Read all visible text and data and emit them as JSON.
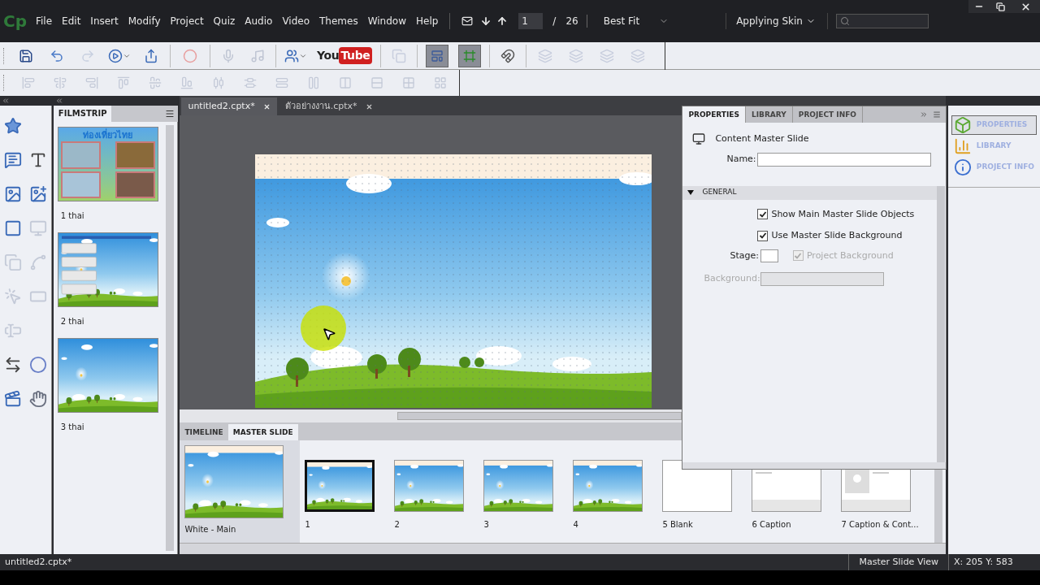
{
  "app": {
    "logo": "Cp"
  },
  "menu": [
    "File",
    "Edit",
    "Insert",
    "Modify",
    "Project",
    "Quiz",
    "Audio",
    "Video",
    "Themes",
    "Window",
    "Help"
  ],
  "nav": {
    "page": "1",
    "separator": "/",
    "total": "26",
    "zoom": "Best Fit"
  },
  "workspace": "Applying Skin",
  "toolbar": {
    "youtube_1": "You",
    "youtube_2": "Tube"
  },
  "doc_tabs": [
    {
      "label": "untitled2.cptx*",
      "selected": true
    },
    {
      "label": "ตัวอย่างงาน.cptx*",
      "selected": false
    }
  ],
  "filmstrip": {
    "title": "FILMSTRIP",
    "slides": [
      {
        "label": "1 thai",
        "kind": "photos",
        "heading": "ท่องเที่ยวไทย",
        "selected": false
      },
      {
        "label": "2 thai",
        "kind": "menu",
        "selected": false
      },
      {
        "label": "3 thai",
        "kind": "sky",
        "selected": false
      }
    ]
  },
  "properties": {
    "tabs": [
      {
        "label": "PROPERTIES",
        "selected": true
      },
      {
        "label": "LIBRARY",
        "selected": false
      },
      {
        "label": "PROJECT INFO",
        "selected": false
      }
    ],
    "heading": "Content Master Slide",
    "name_label": "Name:",
    "section": {
      "label": "GENERAL",
      "expanded": true
    },
    "options": [
      {
        "label": "Show Main Master Slide Objects",
        "checked": true,
        "disabled": false
      },
      {
        "label": "Use Master Slide Background",
        "checked": true,
        "disabled": false
      }
    ],
    "stage_label": "Stage:",
    "project_background": {
      "label": "Project Background",
      "checked": true,
      "disabled": true
    },
    "background_label": "Background:"
  },
  "side_panel": [
    {
      "label": "PROPERTIES",
      "kind": "properties",
      "selected": true
    },
    {
      "label": "LIBRARY",
      "kind": "library",
      "selected": false
    },
    {
      "label": "PROJECT INFO",
      "kind": "info",
      "selected": false
    }
  ],
  "bottom": {
    "tabs": [
      {
        "label": "TIMELINE",
        "selected": false
      },
      {
        "label": "MASTER SLIDE",
        "selected": true
      }
    ],
    "main": {
      "label": "White - Main"
    },
    "slides": [
      {
        "label": "1",
        "kind": "sky",
        "selected": true
      },
      {
        "label": "2",
        "kind": "sky",
        "selected": false
      },
      {
        "label": "3",
        "kind": "sky",
        "selected": false
      },
      {
        "label": "4",
        "kind": "sky",
        "selected": false
      },
      {
        "label": "5 Blank",
        "kind": "blank",
        "selected": false
      },
      {
        "label": "6 Caption",
        "kind": "caption",
        "selected": false
      },
      {
        "label": "7 Caption & Cont...",
        "kind": "caption_content",
        "selected": false
      }
    ]
  },
  "status": {
    "file": "untitled2.cptx*",
    "view": "Master Slide View",
    "coords": "X: 205 Y: 583"
  }
}
